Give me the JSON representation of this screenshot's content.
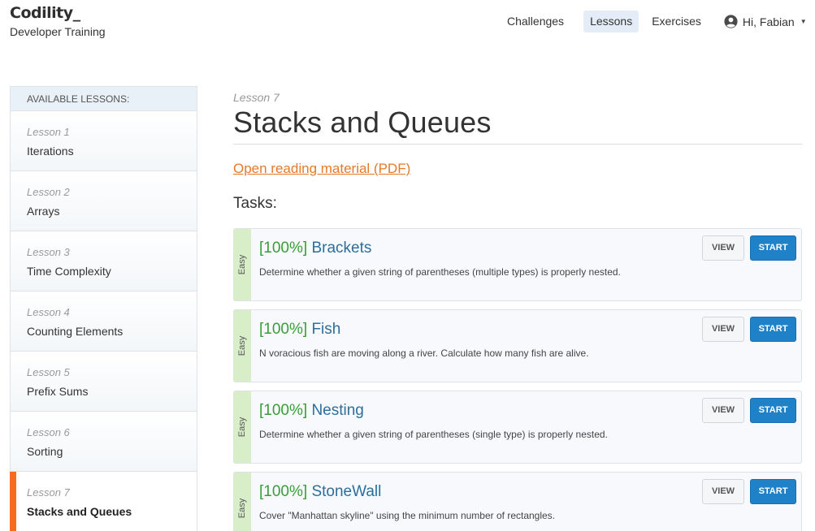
{
  "brand": {
    "logo": "Codility_",
    "subtitle": "Developer Training"
  },
  "nav": {
    "items": [
      "Challenges",
      "Lessons",
      "Exercises"
    ],
    "active": "Lessons",
    "user_greeting": "Hi, Fabian"
  },
  "sidebar": {
    "heading": "AVAILABLE LESSONS:",
    "lessons": [
      {
        "number": "Lesson 1",
        "title": "Iterations"
      },
      {
        "number": "Lesson 2",
        "title": "Arrays"
      },
      {
        "number": "Lesson 3",
        "title": "Time Complexity"
      },
      {
        "number": "Lesson 4",
        "title": "Counting Elements"
      },
      {
        "number": "Lesson 5",
        "title": "Prefix Sums"
      },
      {
        "number": "Lesson 6",
        "title": "Sorting"
      },
      {
        "number": "Lesson 7",
        "title": "Stacks and Queues"
      }
    ],
    "active_lesson": "Lesson 7"
  },
  "main": {
    "lesson_label": "Lesson 7",
    "title": "Stacks and Queues",
    "reading_link": "Open reading material (PDF)",
    "tasks_heading": "Tasks:",
    "tasks": [
      {
        "difficulty": "Easy",
        "score": "[100%]",
        "name": "Brackets",
        "description": "Determine whether a given string of parentheses (multiple types) is properly nested.",
        "view": "VIEW",
        "start": "START"
      },
      {
        "difficulty": "Easy",
        "score": "[100%]",
        "name": "Fish",
        "description": "N voracious fish are moving along a river. Calculate how many fish are alive.",
        "view": "VIEW",
        "start": "START"
      },
      {
        "difficulty": "Easy",
        "score": "[100%]",
        "name": "Nesting",
        "description": "Determine whether a given string of parentheses (single type) is properly nested.",
        "view": "VIEW",
        "start": "START"
      },
      {
        "difficulty": "Easy",
        "score": "[100%]",
        "name": "StoneWall",
        "description": "Cover \"Manhattan skyline\" using the minimum number of rectangles.",
        "view": "VIEW",
        "start": "START"
      }
    ]
  },
  "colors": {
    "accent_orange": "#f66c1e",
    "link_orange": "#e8792a",
    "score_green": "#3a9d3a",
    "task_name_blue": "#2c6e9c",
    "start_button_blue": "#1f82c9",
    "easy_badge_green": "#d8eec9",
    "active_nav_bg": "#e4edf7"
  },
  "icons": {
    "user": "user-avatar-icon",
    "dropdown": "caret-down-icon"
  }
}
